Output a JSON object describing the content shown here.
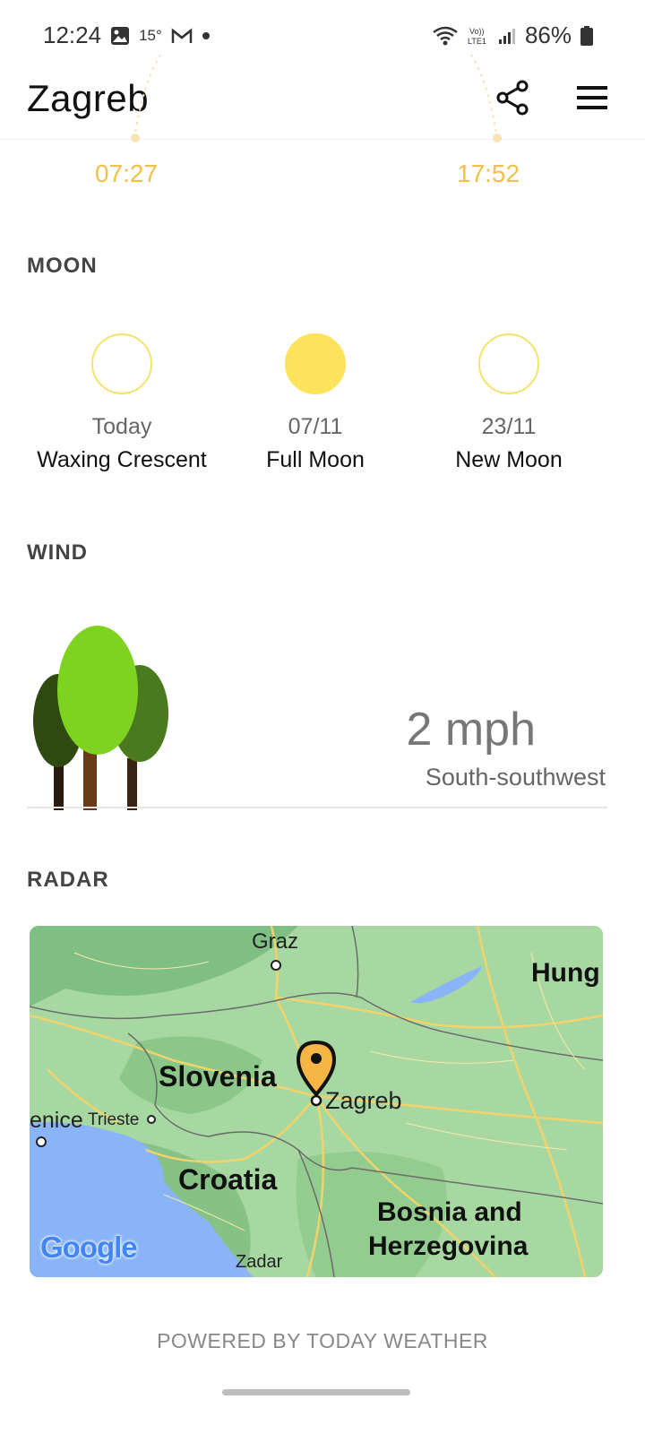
{
  "status": {
    "time": "12:24",
    "temp": "15°",
    "network": "LTE1",
    "battery": "86%"
  },
  "header": {
    "city": "Zagreb"
  },
  "sun": {
    "sunrise": "07:27",
    "sunset": "17:52"
  },
  "moon": {
    "title": "MOON",
    "items": [
      {
        "date": "Today",
        "phase": "Waxing Crescent"
      },
      {
        "date": "07/11",
        "phase": "Full Moon"
      },
      {
        "date": "23/11",
        "phase": "New Moon"
      }
    ]
  },
  "wind": {
    "title": "WIND",
    "speed": "2 mph",
    "direction": "South-southwest"
  },
  "radar": {
    "title": "RADAR",
    "labels": {
      "graz": "Graz",
      "hungary": "Hung",
      "slovenia": "Slovenia",
      "zagreb": "Zagreb",
      "venice": "enice",
      "trieste": "Trieste",
      "croatia": "Croatia",
      "bosnia1": "Bosnia and",
      "bosnia2": "Herzegovina",
      "zadar": "Zadar"
    },
    "logo": "Google"
  },
  "footer": {
    "powered": "POWERED BY TODAY WEATHER"
  },
  "colors": {
    "sun": "#f2c048",
    "moon": "#fde35c",
    "tree_light": "#7ed321",
    "tree_dark": "#2f4a10",
    "tree_mid": "#4a7a1e",
    "map_land": "#9fd39b",
    "map_water": "#8ab4f8",
    "pin": "#f7b545"
  }
}
